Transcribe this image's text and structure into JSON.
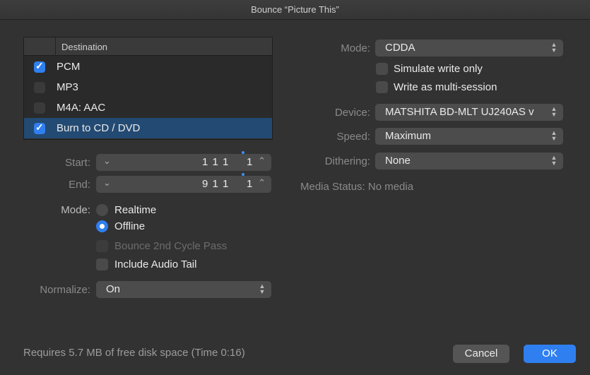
{
  "window": {
    "title": "Bounce “Picture This”"
  },
  "destination": {
    "header": "Destination",
    "items": [
      {
        "label": "PCM",
        "checked": true
      },
      {
        "label": "MP3",
        "checked": false
      },
      {
        "label": "M4A: AAC",
        "checked": false
      },
      {
        "label": "Burn to CD / DVD",
        "checked": true,
        "selected": true
      }
    ]
  },
  "range": {
    "start_label": "Start:",
    "start_value": "1 1 1",
    "start_sub": "1",
    "end_label": "End:",
    "end_value": "9 1 1",
    "end_sub": "1"
  },
  "bounce_mode": {
    "label": "Mode:",
    "realtime": "Realtime",
    "offline": "Offline",
    "selected": "Offline"
  },
  "options": {
    "bounce_2nd_cycle": "Bounce 2nd Cycle Pass",
    "include_audio_tail": "Include Audio Tail"
  },
  "normalize": {
    "label": "Normalize:",
    "value": "On"
  },
  "burn": {
    "mode_label": "Mode:",
    "mode_value": "CDDA",
    "simulate": "Simulate write only",
    "multisession": "Write as multi-session",
    "device_label": "Device:",
    "device_value": "MATSHITA BD-MLT UJ240AS v",
    "speed_label": "Speed:",
    "speed_value": "Maximum",
    "dithering_label": "Dithering:",
    "dithering_value": "None",
    "media_status": "Media Status: No media"
  },
  "footer": {
    "disk_info": "Requires 5.7 MB of free disk space  (Time 0:16)",
    "cancel": "Cancel",
    "ok": "OK"
  },
  "colors": {
    "accent": "#2f7ff0",
    "selection": "#234a72",
    "background": "#323232"
  }
}
